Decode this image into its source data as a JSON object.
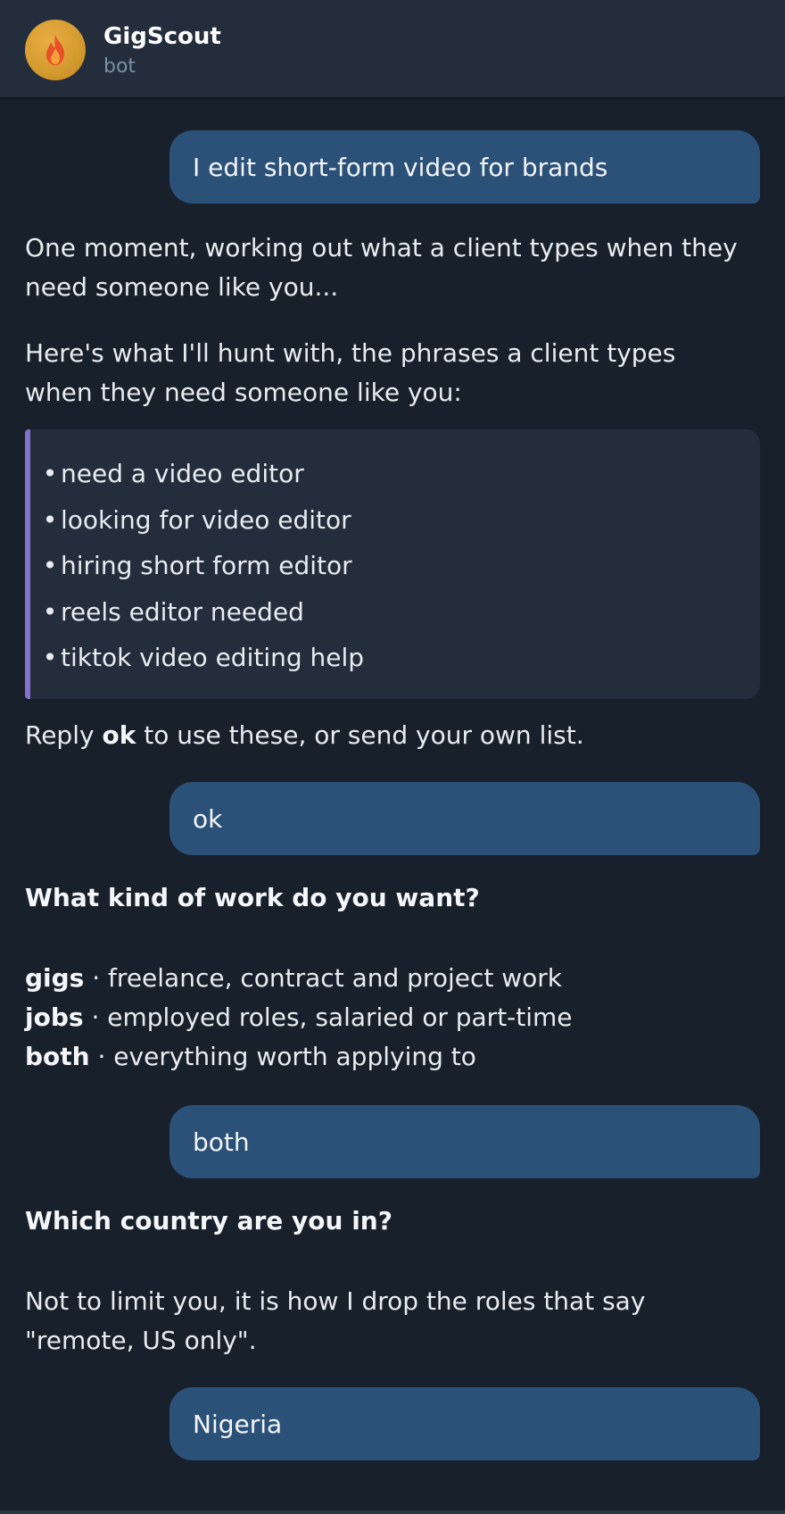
{
  "header": {
    "name": "GigScout",
    "subtitle": "bot"
  },
  "messages": {
    "user1": "I edit short-form video for brands",
    "bot1": "One moment, working out what a client types when they need someone like you...",
    "bot2": "Here's what I'll hunt with, the phrases a client types when they need someone like you:",
    "phrases": [
      "need a video editor",
      "looking for video editor",
      "hiring short form editor",
      "reels editor needed",
      "tiktok video editing help"
    ],
    "bot3_pre": "Reply ",
    "bot3_bold": "ok",
    "bot3_post": " to use these, or send your own list.",
    "user2": "ok",
    "bot4_question": "What kind of work do you want?",
    "options": [
      {
        "key": "gigs",
        "desc": " · freelance, contract and project work"
      },
      {
        "key": "jobs",
        "desc": " · employed roles, salaried or part-time"
      },
      {
        "key": "both",
        "desc": " · everything worth applying to"
      }
    ],
    "user3": "both",
    "bot5_question": "Which country are you in?",
    "bot5_note": "Not to limit you, it is how I drop the roles that say \"remote, US only\".",
    "user4": "Nigeria"
  },
  "colors": {
    "background": "#18202b",
    "header": "#232d3b",
    "user_bubble": "#2c5178",
    "quote_accent": "#8571cc"
  },
  "icons": {
    "avatar": "fire-icon"
  }
}
